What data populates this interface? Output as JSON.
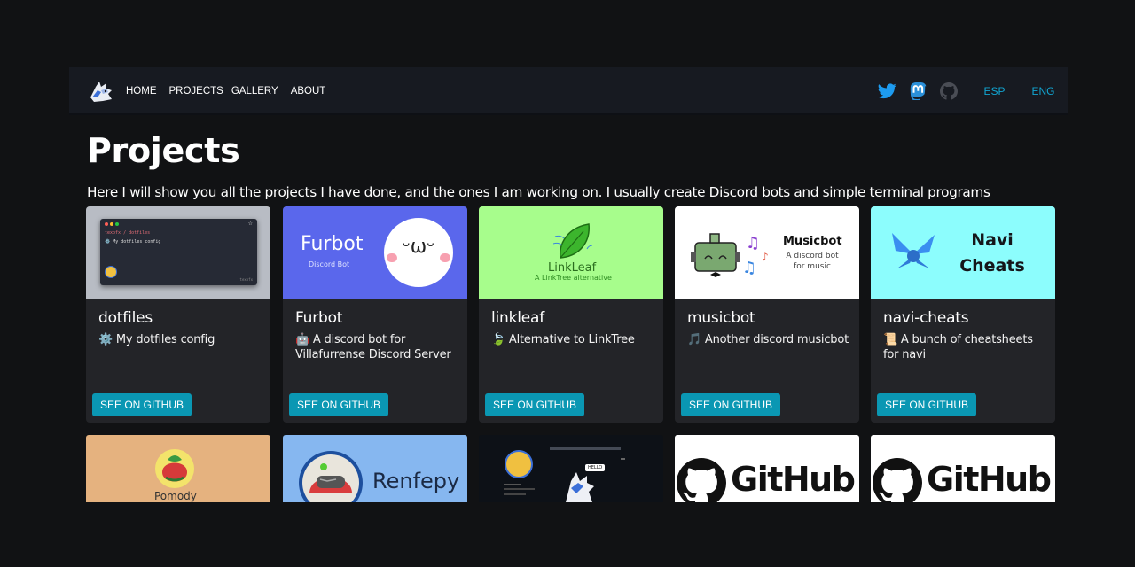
{
  "nav": {
    "links": [
      "HOME",
      "PROJECTS",
      "GALLERY",
      "ABOUT"
    ],
    "social": [
      "twitter-icon",
      "mastodon-icon",
      "github-icon"
    ],
    "langs": [
      "ESP",
      "ENG"
    ]
  },
  "page": {
    "title": "Projects",
    "subtitle": "Here I will show you all the projects I have done, and the ones I am working on. I usually create Discord bots and simple terminal programs"
  },
  "projects": [
    {
      "name": "dotfiles",
      "desc": "⚙️ My dotfiles config",
      "button": "SEE ON GITHUB",
      "thumb": {
        "path": "texofx / dotfiles",
        "line": "⚙️ My dotfiles config",
        "footer": "texofx"
      }
    },
    {
      "name": "Furbot",
      "desc": "🤖 A discord bot for Villafurrense Discord Server",
      "button": "SEE ON GITHUB",
      "thumb": {
        "title": "Furbot",
        "sub": "Discord Bot",
        "face": "ᵕωᵕ"
      }
    },
    {
      "name": "linkleaf",
      "desc": "🍃 Alternative to LinkTree",
      "button": "SEE ON GITHUB",
      "thumb": {
        "title": "LinkLeaf",
        "sub": "A LinkTree alternative"
      }
    },
    {
      "name": "musicbot",
      "desc": "🎵 Another discord musicbot",
      "button": "SEE ON GITHUB",
      "thumb": {
        "title": "Musicbot",
        "sub": "A discord bot for music"
      }
    },
    {
      "name": "navi-cheats",
      "desc": "📜 A bunch of cheatsheets for navi",
      "button": "SEE ON GITHUB",
      "thumb": {
        "title": "Navi Cheats"
      }
    }
  ],
  "row2": {
    "pomody": "Pomody",
    "renfepy": "Renfepy",
    "hello": "HELLO",
    "github": "GitHub"
  },
  "colors": {
    "accent": "#0a97b3",
    "link": "#11a4d0",
    "twitter": "#1d9bf0",
    "card": "#232428",
    "bg": "#111214"
  }
}
